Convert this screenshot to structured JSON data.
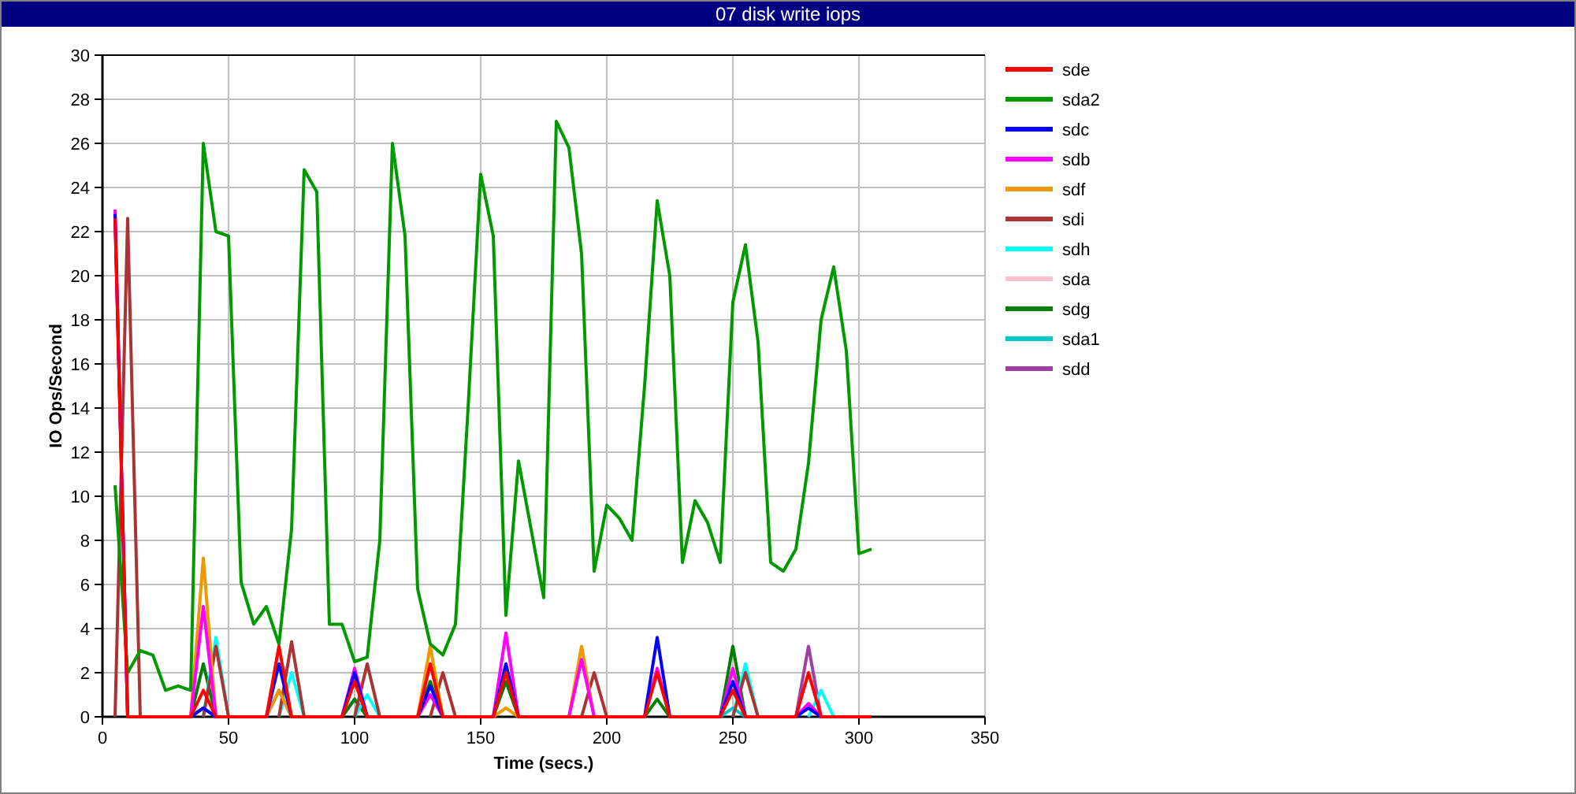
{
  "window": {
    "title": "07 disk write iops"
  },
  "chart_data": {
    "type": "line",
    "xlabel": "Time (secs.)",
    "ylabel": "IO Ops/Second",
    "xlim": [
      0,
      350
    ],
    "ylim": [
      0,
      30
    ],
    "xticks": [
      0,
      50,
      100,
      150,
      200,
      250,
      300,
      350
    ],
    "yticks": [
      0,
      2,
      4,
      6,
      8,
      10,
      12,
      14,
      16,
      18,
      20,
      22,
      24,
      26,
      28,
      30
    ],
    "x": [
      5,
      10,
      15,
      20,
      25,
      30,
      35,
      40,
      45,
      50,
      55,
      60,
      65,
      70,
      75,
      80,
      85,
      90,
      95,
      100,
      105,
      110,
      115,
      120,
      125,
      130,
      135,
      140,
      145,
      150,
      155,
      160,
      165,
      170,
      175,
      180,
      185,
      190,
      195,
      200,
      205,
      210,
      215,
      220,
      225,
      230,
      235,
      240,
      245,
      250,
      255,
      260,
      265,
      270,
      275,
      280,
      285,
      290,
      295,
      300,
      305
    ],
    "series": [
      {
        "name": "sde",
        "color": "#ff0000",
        "values": [
          22.6,
          0,
          0,
          0,
          0,
          0,
          0,
          1.2,
          0,
          0,
          0,
          0,
          0,
          3.2,
          0,
          0,
          0,
          0,
          0,
          1.6,
          0,
          0,
          0,
          0,
          0,
          2.4,
          0,
          0,
          0,
          0,
          0,
          2,
          0,
          0,
          0,
          0,
          0,
          0,
          0,
          0,
          0,
          0,
          0,
          2,
          0,
          0,
          0,
          0,
          0,
          1.2,
          0,
          0,
          0,
          0,
          0,
          2,
          0,
          0,
          0,
          0,
          0
        ]
      },
      {
        "name": "sda2",
        "color": "#009900",
        "values": [
          10.5,
          2,
          3,
          2.8,
          1.2,
          1.4,
          1.2,
          26,
          22,
          21.8,
          6.1,
          4.2,
          5,
          3.3,
          8.5,
          24.8,
          23.8,
          4.2,
          4.2,
          2.5,
          2.7,
          8,
          26,
          21.8,
          5.8,
          3.3,
          2.8,
          4.2,
          14,
          24.6,
          21.8,
          4.6,
          11.6,
          8.5,
          5.4,
          27,
          25.8,
          21,
          6.6,
          9.6,
          9,
          8,
          15,
          23.4,
          20,
          7,
          9.8,
          8.8,
          7,
          18.8,
          21.4,
          17,
          7,
          6.6,
          7.6,
          11.5,
          18,
          20.4,
          16.6,
          7.4,
          7.6
        ]
      },
      {
        "name": "sdc",
        "color": "#0000ff",
        "values": [
          22.8,
          0,
          null,
          null,
          null,
          null,
          0,
          0.4,
          0,
          null,
          null,
          null,
          0,
          2.4,
          0,
          null,
          null,
          null,
          0,
          2,
          0,
          null,
          null,
          null,
          0,
          1.4,
          0,
          null,
          null,
          null,
          0,
          2.4,
          0,
          null,
          null,
          null,
          null,
          null,
          null,
          null,
          null,
          null,
          0,
          3.6,
          0,
          null,
          null,
          null,
          0,
          1.6,
          0,
          null,
          null,
          null,
          0,
          0.4,
          0,
          null,
          null,
          null,
          null
        ]
      },
      {
        "name": "sdb",
        "color": "#ff00ff",
        "values": [
          23,
          0,
          null,
          null,
          null,
          null,
          0,
          5,
          0,
          null,
          null,
          null,
          null,
          null,
          null,
          null,
          null,
          null,
          0,
          2.2,
          0,
          null,
          null,
          null,
          0,
          1,
          0,
          null,
          null,
          null,
          0,
          3.8,
          0,
          null,
          null,
          null,
          0,
          2.6,
          0,
          null,
          null,
          null,
          0,
          2.2,
          0,
          null,
          null,
          null,
          0,
          2.2,
          0,
          null,
          null,
          null,
          0,
          0.6,
          0,
          null,
          null,
          null,
          null
        ]
      },
      {
        "name": "sdf",
        "color": "#ee9900",
        "values": [
          null,
          null,
          null,
          null,
          null,
          null,
          0,
          7.2,
          0,
          null,
          null,
          null,
          0,
          1.2,
          0,
          null,
          null,
          null,
          null,
          null,
          null,
          null,
          null,
          null,
          0,
          3.2,
          0,
          null,
          null,
          null,
          0,
          0.4,
          0,
          null,
          null,
          null,
          0,
          3.2,
          0,
          null,
          null,
          null,
          null,
          null,
          null,
          null,
          null,
          null,
          null,
          null,
          null,
          null,
          null,
          null,
          null,
          null,
          null,
          null,
          null,
          null,
          null
        ]
      },
      {
        "name": "sdi",
        "color": "#aa3333",
        "values": [
          0,
          22.6,
          0,
          null,
          null,
          null,
          null,
          0,
          3.2,
          0,
          null,
          null,
          null,
          0,
          3.4,
          0,
          null,
          null,
          null,
          0,
          2.4,
          0,
          null,
          null,
          null,
          0,
          2,
          0,
          null,
          null,
          null,
          null,
          null,
          null,
          null,
          null,
          null,
          0,
          2,
          0,
          null,
          null,
          null,
          null,
          null,
          null,
          null,
          null,
          null,
          0,
          2,
          0,
          null,
          null,
          null,
          null,
          null,
          null,
          null,
          null,
          null
        ]
      },
      {
        "name": "sdh",
        "color": "#00ffff",
        "values": [
          null,
          null,
          null,
          null,
          null,
          null,
          null,
          0,
          3.6,
          0,
          null,
          null,
          null,
          0,
          2,
          0,
          null,
          null,
          null,
          0,
          1,
          0,
          null,
          null,
          null,
          null,
          null,
          null,
          null,
          null,
          null,
          null,
          null,
          null,
          null,
          null,
          null,
          null,
          null,
          null,
          null,
          null,
          null,
          null,
          null,
          null,
          null,
          null,
          null,
          0,
          2.4,
          0,
          null,
          null,
          null,
          0,
          1.2,
          0,
          null,
          null,
          null
        ]
      },
      {
        "name": "sda",
        "color": "#ffc0cb",
        "values": [
          null,
          null,
          null,
          null,
          null,
          null,
          null,
          null,
          null,
          null,
          null,
          null,
          null,
          null,
          null,
          null,
          null,
          null,
          null,
          null,
          null,
          null,
          null,
          null,
          null,
          null,
          null,
          null,
          null,
          null,
          null,
          null,
          null,
          null,
          null,
          null,
          null,
          null,
          null,
          null,
          null,
          null,
          null,
          null,
          null,
          null,
          null,
          null,
          null,
          null,
          null,
          null,
          null,
          null,
          null,
          null,
          null,
          null,
          null,
          null,
          null
        ]
      },
      {
        "name": "sdg",
        "color": "#008000",
        "values": [
          null,
          null,
          null,
          null,
          null,
          null,
          0,
          2.4,
          0,
          null,
          null,
          null,
          null,
          null,
          null,
          null,
          null,
          null,
          0,
          0.8,
          0,
          null,
          null,
          null,
          0,
          1.6,
          0,
          null,
          null,
          null,
          0,
          1.6,
          0,
          null,
          null,
          null,
          null,
          null,
          null,
          null,
          null,
          null,
          0,
          0.8,
          0,
          null,
          null,
          null,
          0,
          3.2,
          0,
          null,
          null,
          null,
          null,
          null,
          null,
          null,
          null,
          null,
          null
        ]
      },
      {
        "name": "sda1",
        "color": "#00c8c8",
        "values": [
          null,
          null,
          null,
          null,
          null,
          null,
          null,
          null,
          null,
          null,
          null,
          null,
          null,
          null,
          null,
          null,
          null,
          null,
          null,
          null,
          null,
          null,
          null,
          null,
          null,
          null,
          null,
          null,
          null,
          null,
          null,
          null,
          null,
          null,
          null,
          null,
          null,
          null,
          null,
          null,
          null,
          null,
          null,
          null,
          null,
          null,
          null,
          null,
          0,
          0.4,
          0,
          null,
          null,
          null,
          null,
          null,
          null,
          null,
          null,
          null,
          null
        ]
      },
      {
        "name": "sdd",
        "color": "#a040a0",
        "values": [
          null,
          null,
          null,
          null,
          null,
          null,
          0,
          0.4,
          0,
          null,
          null,
          null,
          0,
          1.2,
          0,
          null,
          null,
          null,
          0,
          0.8,
          0,
          null,
          null,
          null,
          null,
          null,
          null,
          null,
          null,
          null,
          null,
          null,
          null,
          null,
          null,
          null,
          null,
          null,
          null,
          null,
          null,
          null,
          null,
          null,
          null,
          null,
          null,
          null,
          null,
          null,
          null,
          null,
          null,
          null,
          0,
          3.2,
          0,
          null,
          null,
          null,
          null
        ]
      }
    ],
    "grid": true,
    "legend": true
  }
}
